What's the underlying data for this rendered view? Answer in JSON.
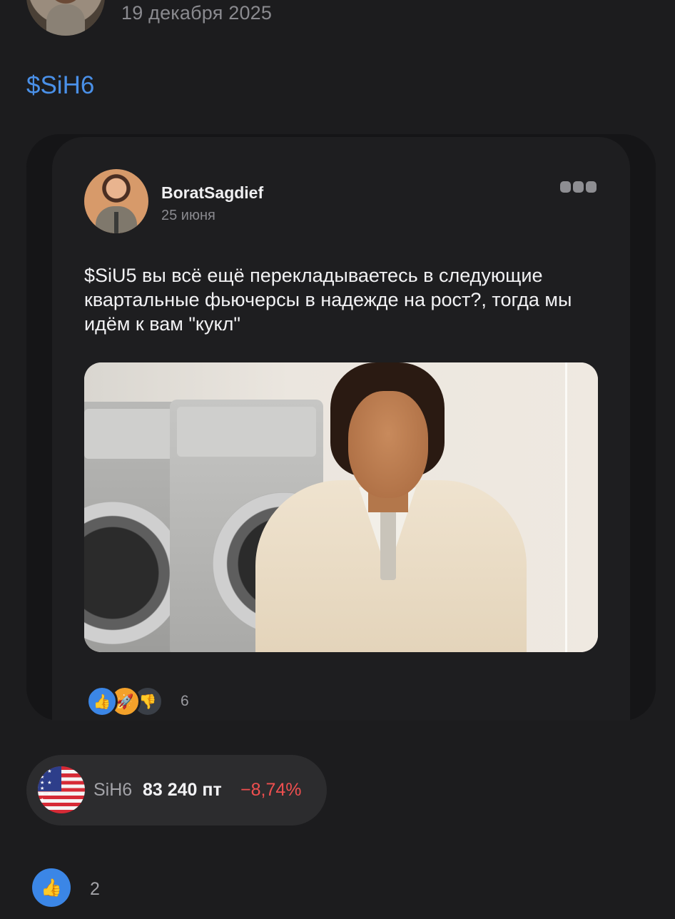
{
  "post": {
    "date": "19 декабря 2025",
    "ticker_link": "$SiH6",
    "likes_count": "2"
  },
  "repost": {
    "author_name": "BoratSagdief",
    "date": "25 июня",
    "text": "$SiU5 вы всё ещё перекладываетесь в следующие квартальные фьючерсы в надежде на рост?, тогда мы идём к вам \"кукл\"",
    "reactions_count": "6",
    "reaction_icons": [
      "thumbs-up",
      "rocket",
      "thumbs-down"
    ]
  },
  "instrument": {
    "ticker": "SiH6",
    "price": "83 240 пт",
    "change": "−8,74%",
    "change_color": "#ef4f4f",
    "flag": "us-flag"
  },
  "colors": {
    "background": "#1c1c1e",
    "link": "#4a90e8",
    "like_blue": "#3b86e6"
  }
}
